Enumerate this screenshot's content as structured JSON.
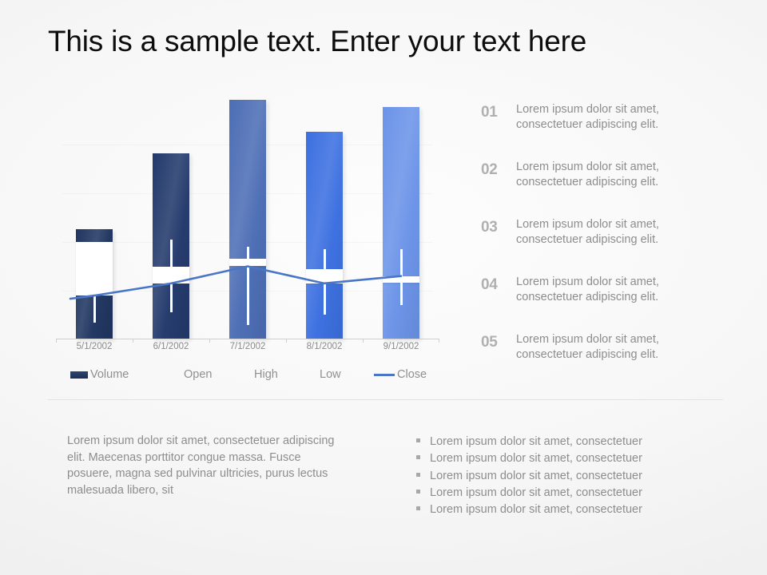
{
  "title": "This is a sample text. Enter your text here",
  "chart_data": {
    "type": "bar",
    "title": "",
    "xlabel": "",
    "ylabel": "",
    "categories": [
      "5/1/2002",
      "6/1/2002",
      "7/1/2002",
      "8/1/2002",
      "9/1/2002"
    ],
    "grid": true,
    "legend_position": "bottom",
    "ylim": [
      0,
      100
    ],
    "series": [
      {
        "name": "Volume",
        "values": [
          45,
          76,
          98,
          85,
          95
        ],
        "colors": [
          "#1f3560",
          "#22396b",
          "#4c6db5",
          "#3b6fe0",
          "#6b93e8"
        ]
      },
      {
        "name": "Open",
        "values": [
          40,
          30,
          33,
          29,
          25
        ]
      },
      {
        "name": "High",
        "values": [
          38,
          41,
          38,
          37,
          37
        ]
      },
      {
        "name": "Low",
        "values": [
          7,
          11,
          6,
          10,
          14
        ]
      },
      {
        "name": "Close",
        "values": [
          18,
          23,
          30,
          23,
          26
        ],
        "color": "#4a76c8"
      }
    ],
    "legend": [
      {
        "label": "Volume",
        "marker": "box",
        "color": "#22365f"
      },
      {
        "label": "Open",
        "marker": "none",
        "color": "#8f8f8f"
      },
      {
        "label": "High",
        "marker": "none",
        "color": "#8f8f8f"
      },
      {
        "label": "Low",
        "marker": "none",
        "color": "#8f8f8f"
      },
      {
        "label": "Close",
        "marker": "line",
        "color": "#4a76c8"
      }
    ]
  },
  "numbered_list": [
    {
      "num": "01",
      "text": "Lorem ipsum dolor sit amet, consectetuer adipiscing elit."
    },
    {
      "num": "02",
      "text": "Lorem ipsum dolor sit amet, consectetuer adipiscing elit."
    },
    {
      "num": "03",
      "text": "Lorem ipsum dolor sit amet, consectetuer adipiscing elit."
    },
    {
      "num": "04",
      "text": "Lorem ipsum dolor sit amet, consectetuer adipiscing elit."
    },
    {
      "num": "05",
      "text": "Lorem ipsum dolor sit amet, consectetuer adipiscing elit."
    }
  ],
  "footer": {
    "paragraph": "Lorem ipsum dolor sit amet, consectetuer adipiscing elit. Maecenas porttitor congue massa. Fusce posuere, magna sed pulvinar ultricies, purus lectus malesuada libero, sit",
    "bullets": [
      "Lorem ipsum dolor sit amet, consectetuer",
      "Lorem ipsum dolor sit amet, consectetuer",
      "Lorem ipsum dolor sit amet, consectetuer",
      "Lorem ipsum dolor sit amet, consectetuer",
      "Lorem ipsum dolor sit amet, consectetuer"
    ]
  }
}
